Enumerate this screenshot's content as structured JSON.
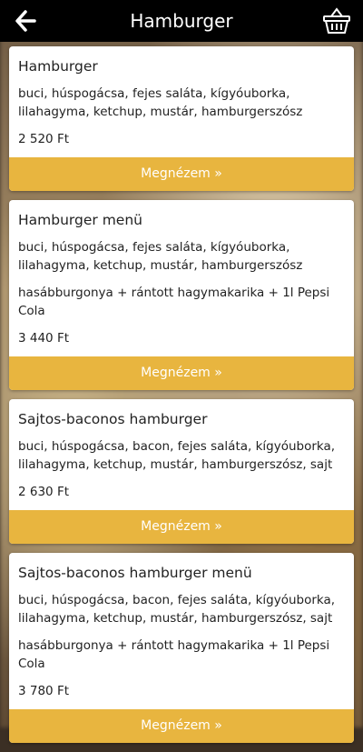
{
  "header": {
    "title": "Hamburger",
    "back_icon": "arrow-left-icon",
    "cart_icon": "basket-icon"
  },
  "colors": {
    "topbar": "#000000",
    "button": "#e8b53f",
    "card": "#ffffff"
  },
  "items": [
    {
      "name": "Hamburger",
      "description": "buci, húspogácsa, fejes saláta, kígyóuborka, lilahagyma, ketchup, mustár, hamburgerszósz",
      "extra": "",
      "price": "2 520 Ft",
      "button": "Megnézem »"
    },
    {
      "name": "Hamburger menü",
      "description": "buci, húspogácsa, fejes saláta, kígyóuborka, lilahagyma, ketchup, mustár, hamburgerszósz",
      "extra": "hasábburgonya + rántott hagymakarika + 1l Pepsi Cola",
      "price": "3 440 Ft",
      "button": "Megnézem »"
    },
    {
      "name": "Sajtos-baconos hamburger",
      "description": "buci, húspogácsa, bacon, fejes saláta, kígyóuborka, lilahagyma, ketchup, mustár, hamburgerszósz, sajt",
      "extra": "",
      "price": "2 630 Ft",
      "button": "Megnézem »"
    },
    {
      "name": "Sajtos-baconos hamburger menü",
      "description": "buci, húspogácsa, bacon, fejes saláta, kígyóuborka, lilahagyma, ketchup, mustár, hamburgerszósz, sajt",
      "extra": "hasábburgonya + rántott hagymakarika + 1l Pepsi Cola",
      "price": "3 780 Ft",
      "button": "Megnézem »"
    }
  ]
}
